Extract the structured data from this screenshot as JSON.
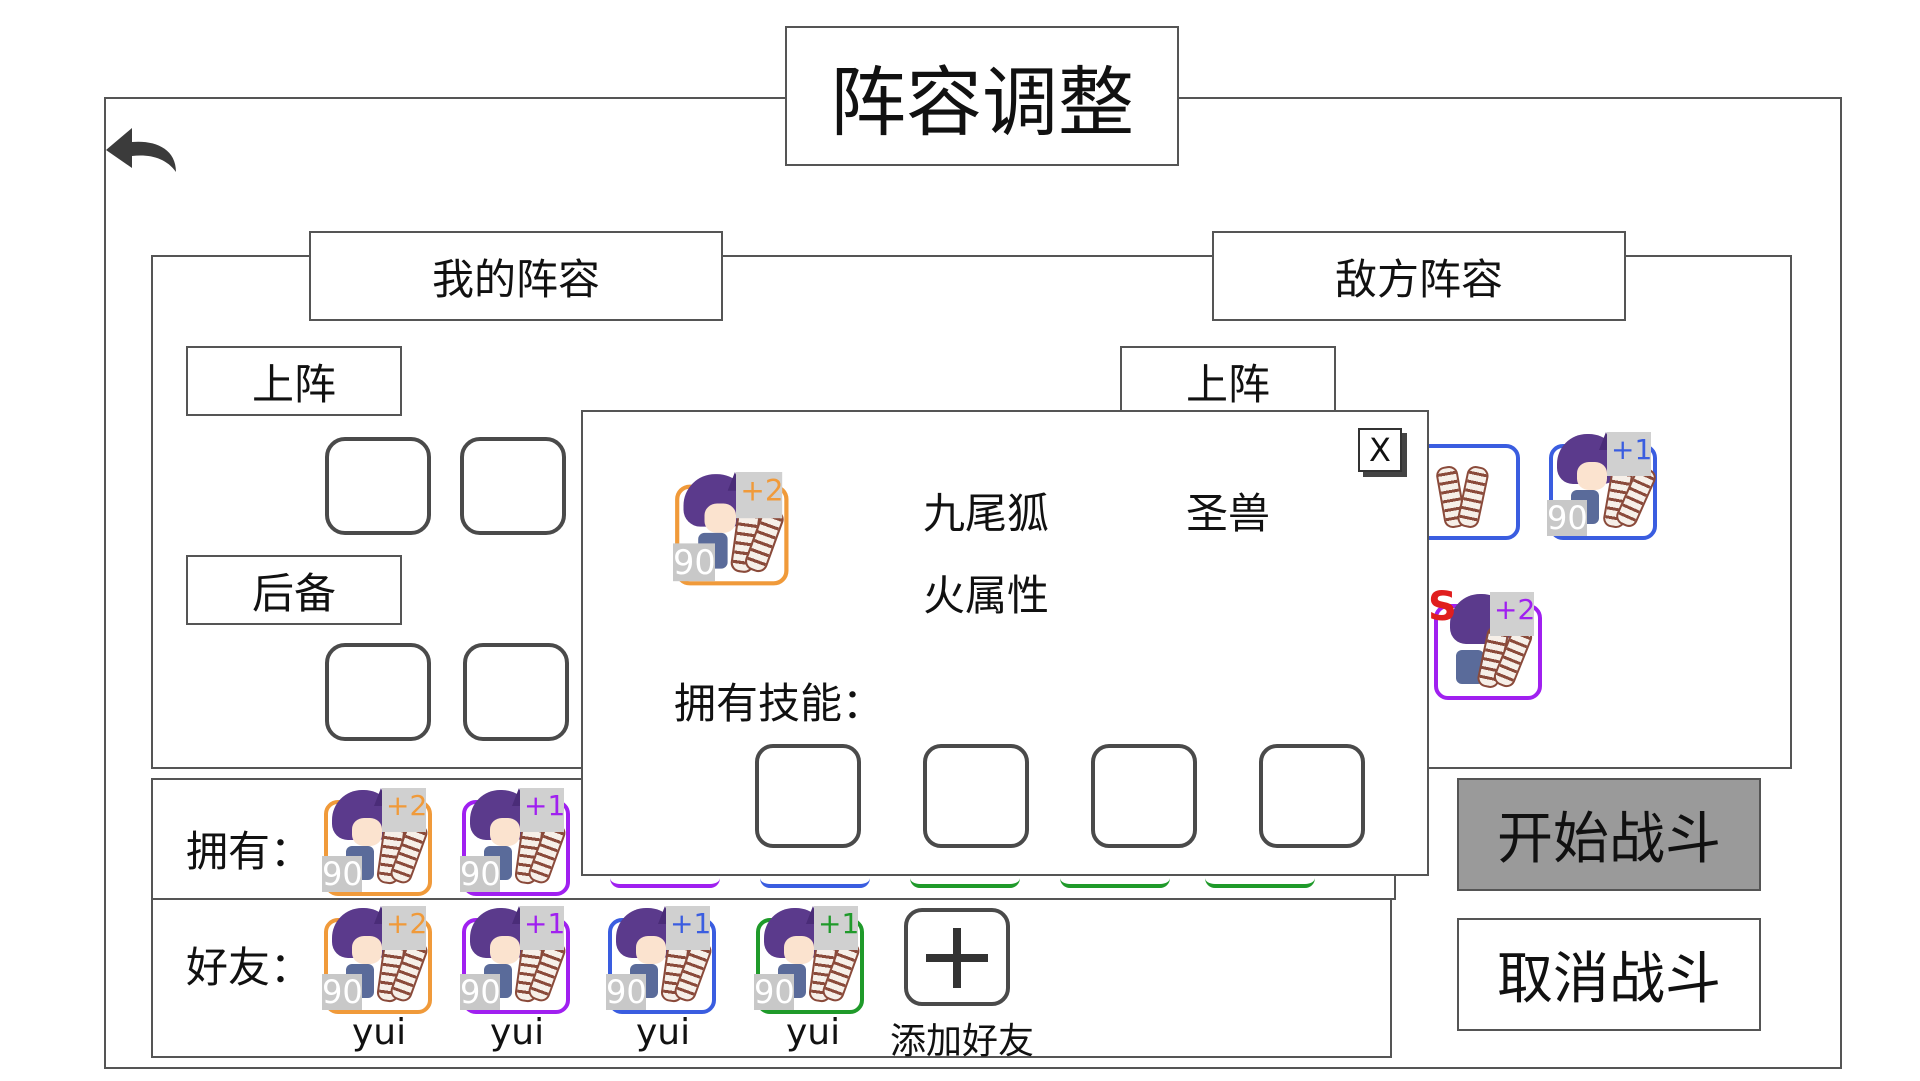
{
  "page": {
    "title": "阵容调整"
  },
  "my_team": {
    "title": "我的阵容",
    "onfield_label": "上阵",
    "reserve_label": "后备"
  },
  "enemy_team": {
    "title": "敌方阵容",
    "onfield_label": "上阵",
    "cards": [
      {
        "level": "90",
        "plus": "+1",
        "color": "#3a5de0"
      },
      {
        "level": "90",
        "plus": "+2",
        "color": "#a020f0",
        "badge": "S"
      }
    ]
  },
  "owned": {
    "label": "拥有：",
    "cards": [
      {
        "level": "90",
        "plus": "+2",
        "color": "#f09a3a"
      },
      {
        "level": "90",
        "plus": "+1",
        "color": "#a020f0"
      }
    ]
  },
  "friends": {
    "label": "好友：",
    "cards": [
      {
        "level": "90",
        "plus": "+2",
        "color": "#f09a3a",
        "name": "yui"
      },
      {
        "level": "90",
        "plus": "+1",
        "color": "#a020f0",
        "name": "yui"
      },
      {
        "level": "90",
        "plus": "+1",
        "color": "#3a5de0",
        "name": "yui"
      },
      {
        "level": "90",
        "plus": "+1",
        "color": "#1f9a2a",
        "name": "yui"
      }
    ],
    "add_label": "添加好友"
  },
  "actions": {
    "start_label": "开始战斗",
    "cancel_label": "取消战斗",
    "start_bg": "#9a9a9a"
  },
  "detail_popup": {
    "close_label": "X",
    "name": "九尾狐",
    "rank": "圣兽",
    "element": "火属性",
    "skills_label": "拥有技能：",
    "card": {
      "level": "90",
      "plus": "+2",
      "color": "#f09a3a"
    }
  }
}
